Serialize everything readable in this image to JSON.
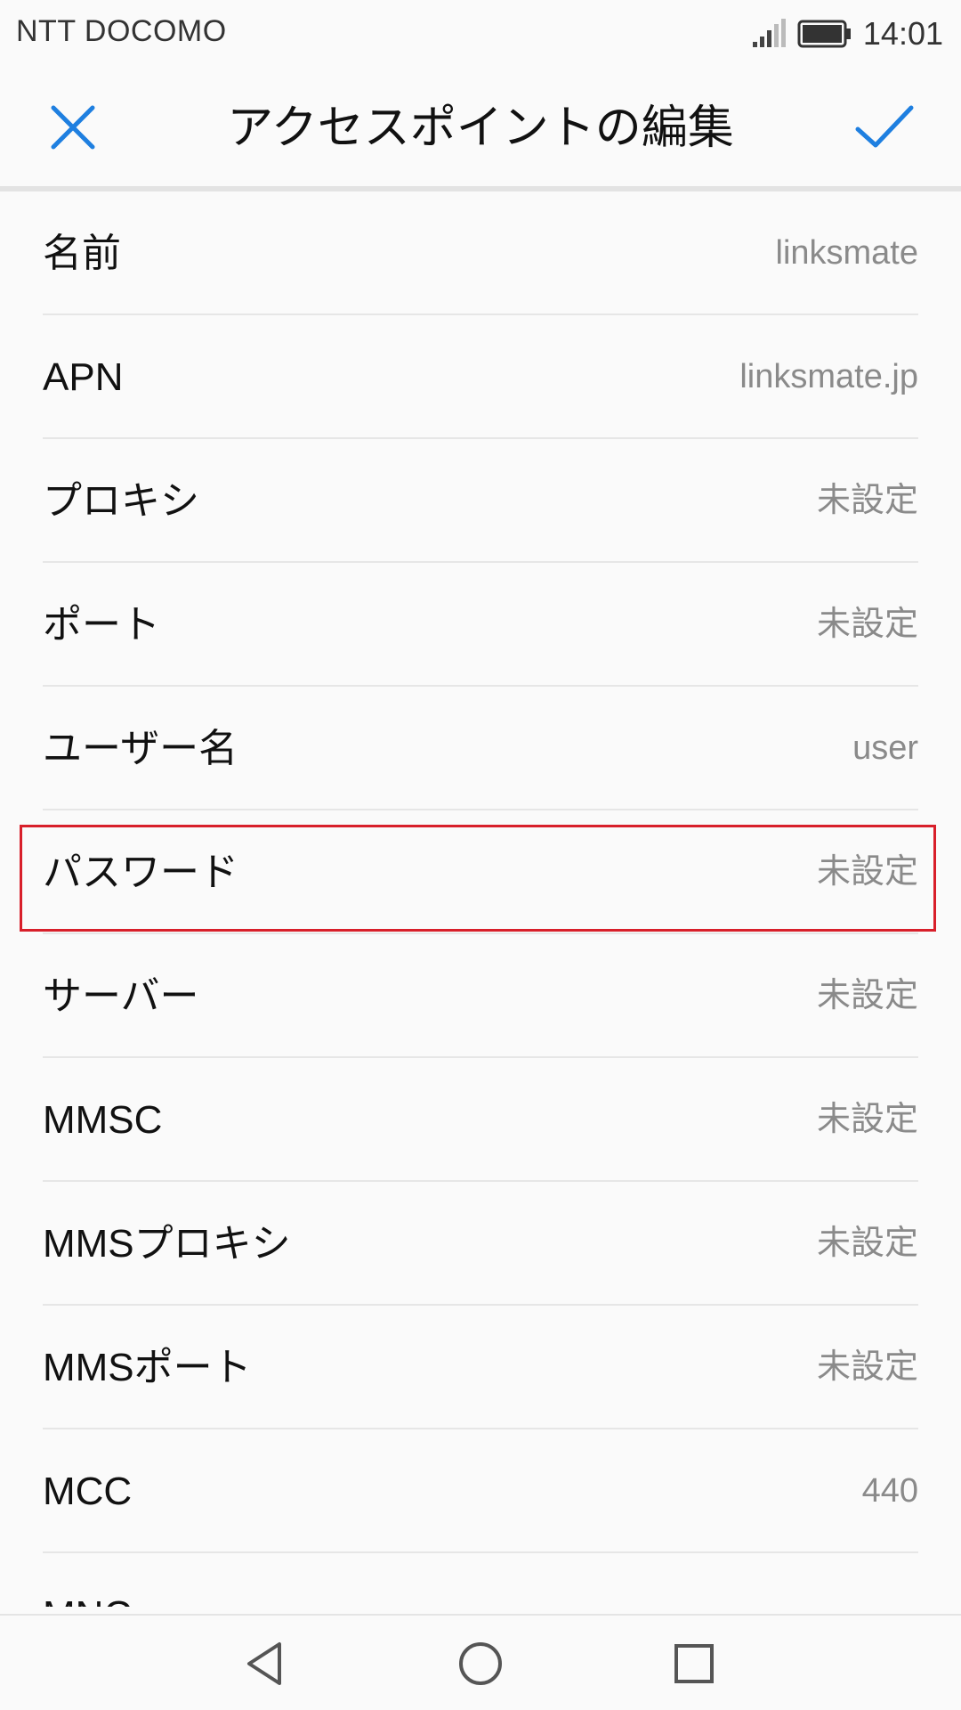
{
  "status_bar": {
    "carrier": "NTT DOCOMO",
    "time": "14:01",
    "signal_icon": "signal-icon",
    "battery_icon": "battery-icon"
  },
  "header": {
    "title": "アクセスポイントの編集",
    "close_icon": "close-icon",
    "confirm_icon": "checkmark-icon",
    "accent_color": "#1e7fe0"
  },
  "apn_fields": [
    {
      "label": "名前",
      "value": "linksmate"
    },
    {
      "label": "APN",
      "value": "linksmate.jp"
    },
    {
      "label": "プロキシ",
      "value": "未設定"
    },
    {
      "label": "ポート",
      "value": "未設定"
    },
    {
      "label": "ユーザー名",
      "value": "user"
    },
    {
      "label": "パスワード",
      "value": "未設定"
    },
    {
      "label": "サーバー",
      "value": "未設定"
    },
    {
      "label": "MMSC",
      "value": "未設定"
    },
    {
      "label": "MMSプロキシ",
      "value": "未設定"
    },
    {
      "label": "MMSポート",
      "value": "未設定"
    },
    {
      "label": "MCC",
      "value": "440"
    },
    {
      "label": "MNC",
      "value": ""
    }
  ],
  "highlight_color": "#d81f2a",
  "nav_bar": {
    "back_icon": "back-triangle-icon",
    "home_icon": "home-circle-icon",
    "recents_icon": "recents-square-icon"
  }
}
